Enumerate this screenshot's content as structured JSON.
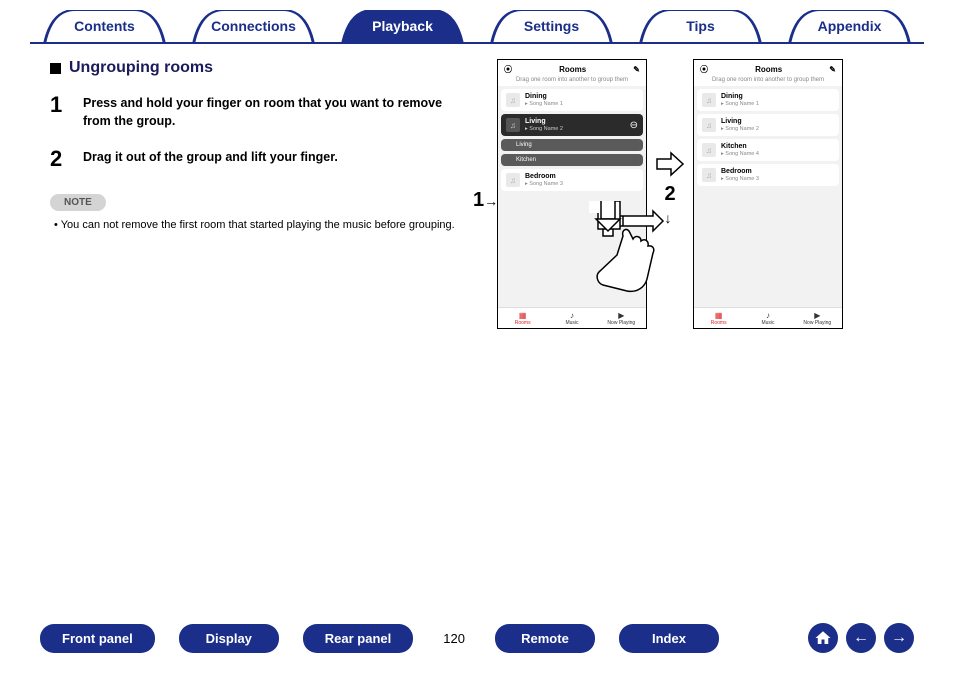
{
  "tabs": {
    "items": [
      "Contents",
      "Connections",
      "Playback",
      "Settings",
      "Tips",
      "Appendix"
    ],
    "active_index": 2
  },
  "section": {
    "title": "Ungrouping rooms",
    "steps": [
      {
        "num": "1",
        "text": "Press and hold your finger on room that you want to remove from the group."
      },
      {
        "num": "2",
        "text": "Drag it out of the group and lift your finger."
      }
    ],
    "note_label": "NOTE",
    "note_text": "You can not remove the first room that started playing the music before grouping."
  },
  "phone_common": {
    "title": "Rooms",
    "hint": "Drag one room into another to group them",
    "footer": {
      "rooms": "Rooms",
      "music": "Music",
      "now": "Now Playing"
    }
  },
  "phone_left": {
    "rooms": [
      {
        "name": "Dining",
        "song": "Song Name 1",
        "style": "light"
      },
      {
        "name": "Living",
        "song": "Song Name 2",
        "style": "dark"
      },
      {
        "name": "Living",
        "song": "",
        "style": "darksub"
      },
      {
        "name": "Kitchen",
        "song": "",
        "style": "darksub"
      },
      {
        "name": "Bedroom",
        "song": "Song Name 3",
        "style": "light"
      }
    ]
  },
  "phone_right": {
    "rooms": [
      {
        "name": "Dining",
        "song": "Song Name 1"
      },
      {
        "name": "Living",
        "song": "Song Name 2"
      },
      {
        "name": "Kitchen",
        "song": "Song Name 4"
      },
      {
        "name": "Bedroom",
        "song": "Song Name 3"
      }
    ]
  },
  "callouts": {
    "one": "1",
    "two": "2"
  },
  "bottom": {
    "buttons": [
      "Front panel",
      "Display",
      "Rear panel"
    ],
    "page": "120",
    "buttons2": [
      "Remote",
      "Index"
    ]
  }
}
